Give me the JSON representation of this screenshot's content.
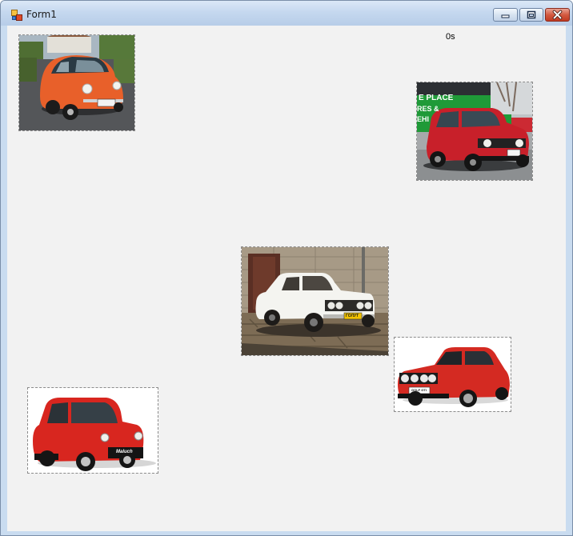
{
  "window": {
    "title": "Form1",
    "controls": {
      "minimize_icon": "minimize-icon",
      "maximize_icon": "maximize-icon",
      "close_icon": "close-icon"
    }
  },
  "timer": {
    "text": "0s"
  },
  "cars": [
    {
      "name": "orange-fiat-600",
      "color": "#e8602a"
    },
    {
      "name": "red-yugo",
      "color": "#c8202a",
      "sign_lines": [
        "E PLACE",
        "RES &",
        "EHI"
      ]
    },
    {
      "name": "white-lada",
      "color": "#f4f4f0",
      "plate": "ГОЛУТ"
    },
    {
      "name": "red-golf-gti",
      "color": "#d42a22",
      "plate": "GOLF GTI"
    },
    {
      "name": "red-fiat-126",
      "color": "#d8261f",
      "plate": "Maluch"
    }
  ]
}
